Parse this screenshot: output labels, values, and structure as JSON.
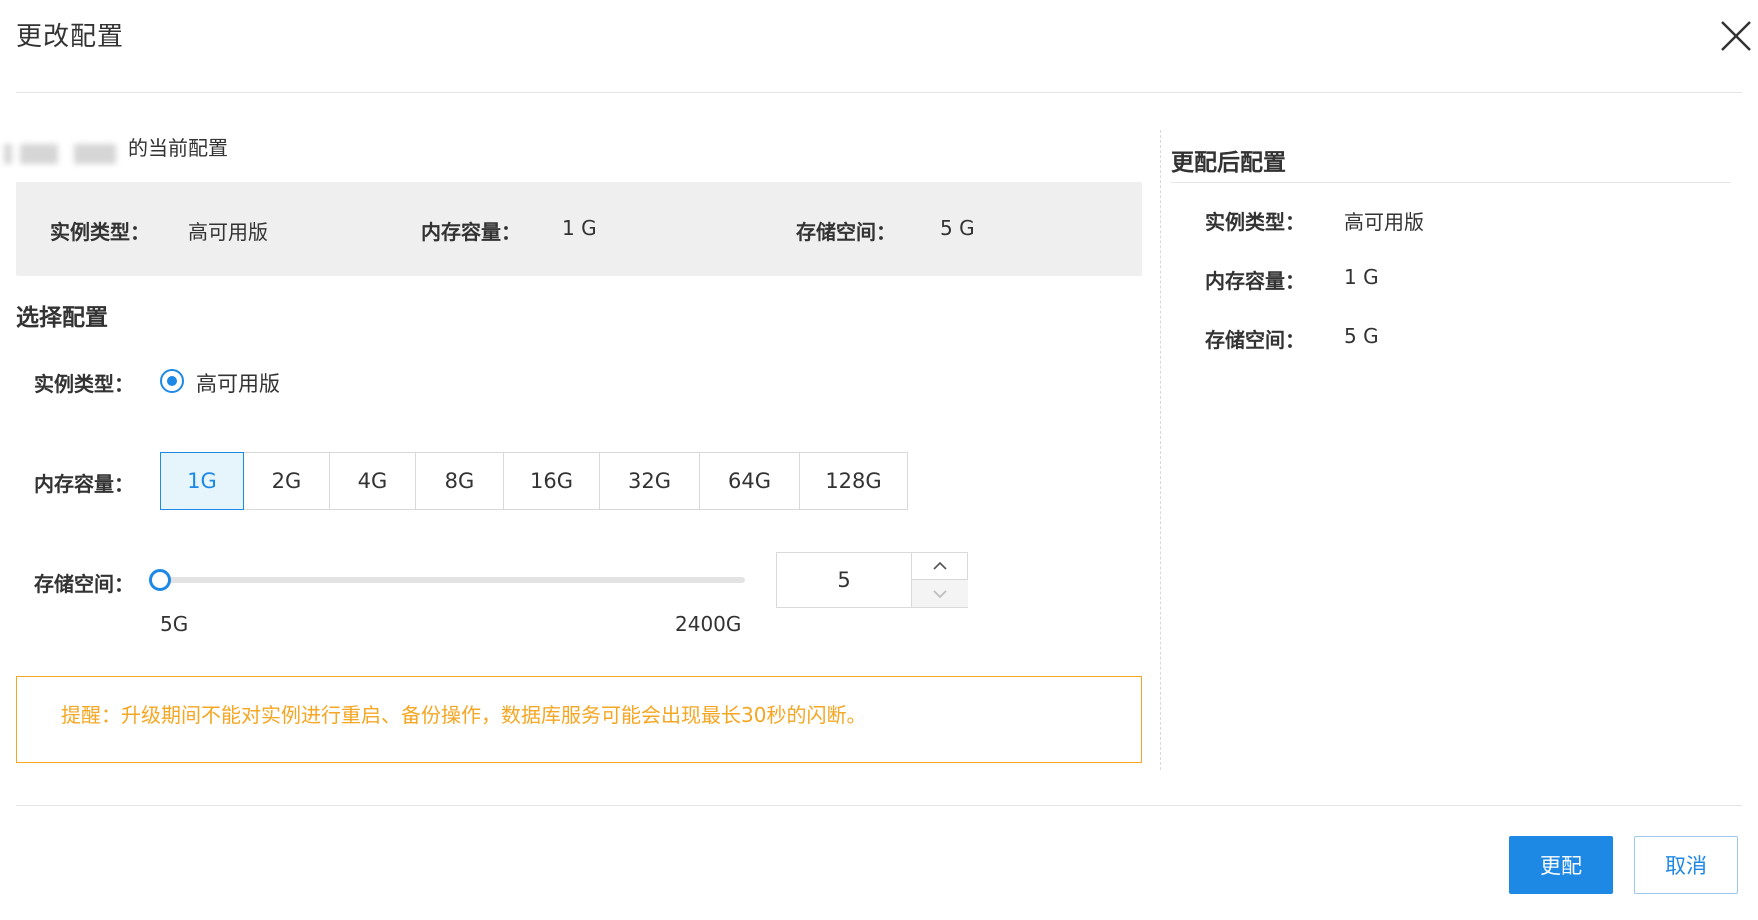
{
  "dialog": {
    "title": "更改配置",
    "close_icon": "close-icon"
  },
  "current": {
    "heading_suffix": "的当前配置",
    "instance_type_label": "实例类型：",
    "instance_type_value": "高可用版",
    "memory_label": "内存容量：",
    "memory_value": "1 G",
    "storage_label": "存储空间：",
    "storage_value": "5 G"
  },
  "select": {
    "title": "选择配置",
    "instance_type_label": "实例类型：",
    "instance_type_option": "高可用版",
    "memory_label": "内存容量：",
    "memory_options": [
      "1G",
      "2G",
      "4G",
      "8G",
      "16G",
      "32G",
      "64G",
      "128G"
    ],
    "memory_selected": "1G",
    "storage_label": "存储空间：",
    "storage_min_label": "5G",
    "storage_max_label": "2400G",
    "storage_value": "5"
  },
  "alert": {
    "text": "提醒：升级期间不能对实例进行重启、备份操作，数据库服务可能会出现最长30秒的闪断。"
  },
  "after": {
    "title": "更配后配置",
    "instance_type_label": "实例类型：",
    "instance_type_value": "高可用版",
    "memory_label": "内存容量：",
    "memory_value": "1 G",
    "storage_label": "存储空间：",
    "storage_value": "5 G"
  },
  "footer": {
    "confirm_label": "更配",
    "cancel_label": "取消"
  },
  "colors": {
    "accent": "#1e88e5",
    "warning": "#f5a623",
    "panel_bg": "#efefef"
  }
}
